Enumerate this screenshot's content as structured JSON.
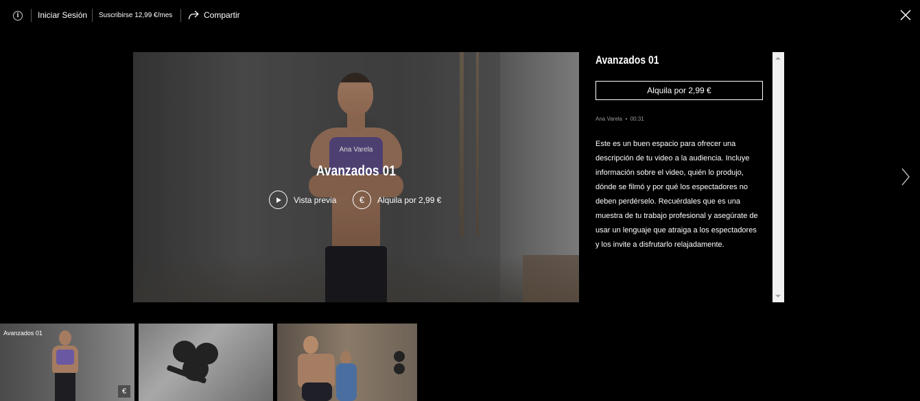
{
  "topbar": {
    "info_icon": "info-icon",
    "login": "Iniciar Sesión",
    "subscribe": "Suscribirse 12,99 €/mes",
    "share": "Compartir"
  },
  "hero": {
    "author": "Ana Varela",
    "title": "Avanzados 01",
    "preview": "Vista previa",
    "euro_symbol": "€",
    "rent": "Alquila por 2,99 €"
  },
  "details": {
    "title": "Avanzados 01",
    "rent_button": "Alquila por 2,99 €",
    "author": "Ana Varela",
    "dot": "•",
    "duration": "00:31",
    "description": "Este es un buen espacio para ofrecer una descripción de tu video a la audiencia. Incluye información sobre el video, quién lo produjo, dónde se filmó y por qué los espectadores no deben perdérselo. Recuérdales que es una muestra de tu trabajo profesional y asegúrate de usar un lenguaje que atraiga a los espectadores y los invite a disfrutarlo relajadamente."
  },
  "thumbnails": [
    {
      "label": "Avanzados 01",
      "badge": "€"
    },
    {
      "label": ""
    },
    {
      "label": ""
    }
  ],
  "colors": {
    "background": "#000000",
    "text": "#ffffff",
    "muted": "#9a9a9a"
  }
}
